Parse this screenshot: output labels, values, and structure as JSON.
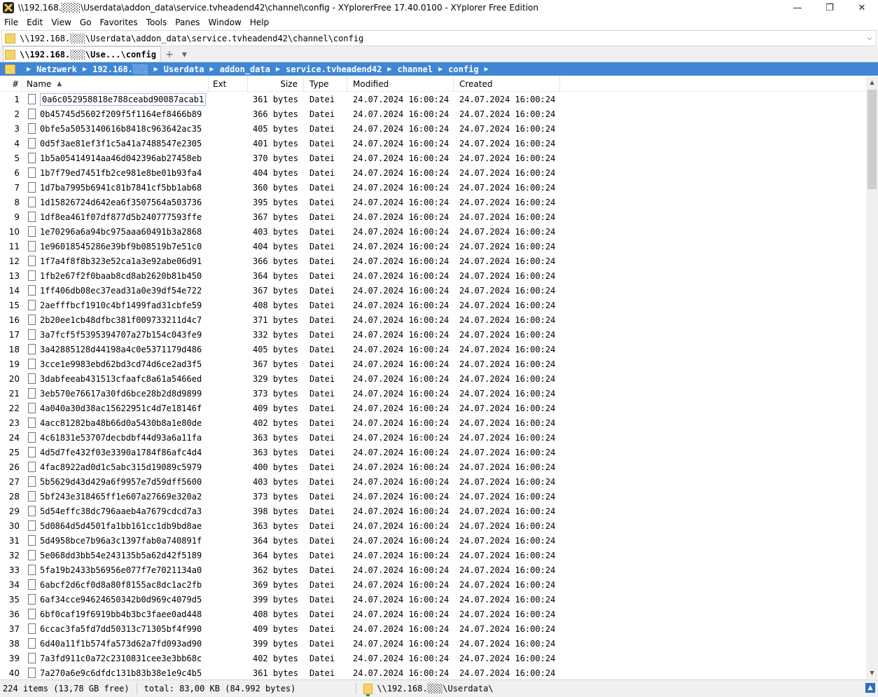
{
  "window": {
    "title": "\\\\192.168.░░░\\Userdata\\addon_data\\service.tvheadend42\\channel\\config - XYplorerFree 17.40.0100 - XYplorer Free Edition",
    "minimize": "—",
    "maximize": "❐",
    "close": "✕"
  },
  "menu": [
    "File",
    "Edit",
    "View",
    "Go",
    "Favorites",
    "Tools",
    "Panes",
    "Window",
    "Help"
  ],
  "address": {
    "value": "\\\\192.168.░░░\\Userdata\\addon_data\\service.tvheadend42\\channel\\config",
    "dropdown": "⌵"
  },
  "tab": {
    "label": "\\\\192.168.░░░\\Use...\\config",
    "add": "+",
    "menu": "▾"
  },
  "breadcrumb": [
    "Netzwerk",
    "192.168.░░░",
    "Userdata",
    "addon_data",
    "service.tvheadend42",
    "channel",
    "config"
  ],
  "breadcrumb_sep": "▶",
  "columns": {
    "num": "#",
    "name": "Name",
    "ext": "Ext",
    "size": "Size",
    "type": "Type",
    "modified": "Modified",
    "created": "Created",
    "sort_indicator": "▲"
  },
  "rows": [
    {
      "n": "1",
      "name": "0a6c052958818e788ceabd90087acab1",
      "size": "361 bytes"
    },
    {
      "n": "2",
      "name": "0b45745d5602f209f5f1164ef8466b89",
      "size": "366 bytes"
    },
    {
      "n": "3",
      "name": "0bfe5a5053140616b8418c963642ac35",
      "size": "405 bytes"
    },
    {
      "n": "4",
      "name": "0d5f3ae81ef3f1c5a41a7488547e2305",
      "size": "401 bytes"
    },
    {
      "n": "5",
      "name": "1b5a05414914aa46d042396ab27458eb",
      "size": "370 bytes"
    },
    {
      "n": "6",
      "name": "1b7f79ed7451fb2ce981e8be01b93fa4",
      "size": "404 bytes"
    },
    {
      "n": "7",
      "name": "1d7ba7995b6941c81b7841cf5bb1ab68",
      "size": "360 bytes"
    },
    {
      "n": "8",
      "name": "1d15826724d642ea6f3507564a503736",
      "size": "395 bytes"
    },
    {
      "n": "9",
      "name": "1df8ea461f07df877d5b240777593ffe",
      "size": "367 bytes"
    },
    {
      "n": "10",
      "name": "1e70296a6a94bc975aaa60491b3a2868",
      "size": "403 bytes"
    },
    {
      "n": "11",
      "name": "1e96018545286e39bf9b08519b7e51c0",
      "size": "404 bytes"
    },
    {
      "n": "12",
      "name": "1f7a4f8f8b323e52ca1a3e92abe06d91",
      "size": "366 bytes"
    },
    {
      "n": "13",
      "name": "1fb2e67f2f0baab8cd8ab2620b81b450",
      "size": "364 bytes"
    },
    {
      "n": "14",
      "name": "1ff406db08ec37ead31a0e39df54e722",
      "size": "367 bytes"
    },
    {
      "n": "15",
      "name": "2aefffbcf1910c4bf1499fad31cbfe59",
      "size": "408 bytes"
    },
    {
      "n": "16",
      "name": "2b20ee1cb48dfbc381f009733211d4c7",
      "size": "371 bytes"
    },
    {
      "n": "17",
      "name": "3a7fcf5f5395394707a27b154c043fe9",
      "size": "332 bytes"
    },
    {
      "n": "18",
      "name": "3a42885128d44198a4c0e5371179d486",
      "size": "405 bytes"
    },
    {
      "n": "19",
      "name": "3cce1e9983ebd62bd3cd74d6ce2ad3f5",
      "size": "367 bytes"
    },
    {
      "n": "20",
      "name": "3dabfeeab431513cfaafc8a61a5466ed",
      "size": "329 bytes"
    },
    {
      "n": "21",
      "name": "3eb570e76617a30fd6bce28b2d8d9899",
      "size": "373 bytes"
    },
    {
      "n": "22",
      "name": "4a040a30d38ac15622951c4d7e18146f",
      "size": "409 bytes"
    },
    {
      "n": "23",
      "name": "4acc81282ba48b66d0a5430b8a1e80de",
      "size": "402 bytes"
    },
    {
      "n": "24",
      "name": "4c61831e53707decbdbf44d93a6a11fa",
      "size": "363 bytes"
    },
    {
      "n": "25",
      "name": "4d5d7fe432f03e3390a1784f86afc4d4",
      "size": "363 bytes"
    },
    {
      "n": "26",
      "name": "4fac8922ad0d1c5abc315d19089c5979",
      "size": "400 bytes"
    },
    {
      "n": "27",
      "name": "5b5629d43d429a6f9957e7d59dff5600",
      "size": "403 bytes"
    },
    {
      "n": "28",
      "name": "5bf243e318465ff1e607a27669e320a2",
      "size": "373 bytes"
    },
    {
      "n": "29",
      "name": "5d54effc38dc796aaeb4a7679cdcd7a3",
      "size": "398 bytes"
    },
    {
      "n": "30",
      "name": "5d0864d5d4501fa1bb161cc1db9bd8ae",
      "size": "363 bytes"
    },
    {
      "n": "31",
      "name": "5d4958bce7b96a3c1397fab0a740891f",
      "size": "364 bytes"
    },
    {
      "n": "32",
      "name": "5e068dd3bb54e243135b5a62d42f5189",
      "size": "364 bytes"
    },
    {
      "n": "33",
      "name": "5fa19b2433b56956e077f7e7021134a0",
      "size": "362 bytes"
    },
    {
      "n": "34",
      "name": "6abcf2d6cf0d8a80f8155ac8dc1ac2fb",
      "size": "369 bytes"
    },
    {
      "n": "35",
      "name": "6af34cce94624650342b0d969c4079d5",
      "size": "399 bytes"
    },
    {
      "n": "36",
      "name": "6bf0caf19f6919bb4b3bc3faee0ad448",
      "size": "408 bytes"
    },
    {
      "n": "37",
      "name": "6ccac3fa5fd7dd50313c71305bf4f990",
      "size": "409 bytes"
    },
    {
      "n": "38",
      "name": "6d40a11f1b574fa573d62a7fd093ad90",
      "size": "399 bytes"
    },
    {
      "n": "39",
      "name": "7a3fd911c0a72c2310831cee3e3bb68c",
      "size": "402 bytes"
    },
    {
      "n": "40",
      "name": "7a270a6e9c6dfdc131b83b38e1e9c4b5",
      "size": "361 bytes"
    }
  ],
  "row_type": "Datei",
  "row_modified": "24.07.2024 16:00:24",
  "row_created": "24.07.2024 16:00:24",
  "status": {
    "items": "224 items (13,78 GB free)",
    "total": "total: 83,00 KB (84.992 bytes)",
    "path": "\\\\192.168.░░░\\Userdata\\"
  },
  "colors": {
    "breadcrumb_bg": "#3f86d6",
    "folder": "#f6d36a"
  }
}
